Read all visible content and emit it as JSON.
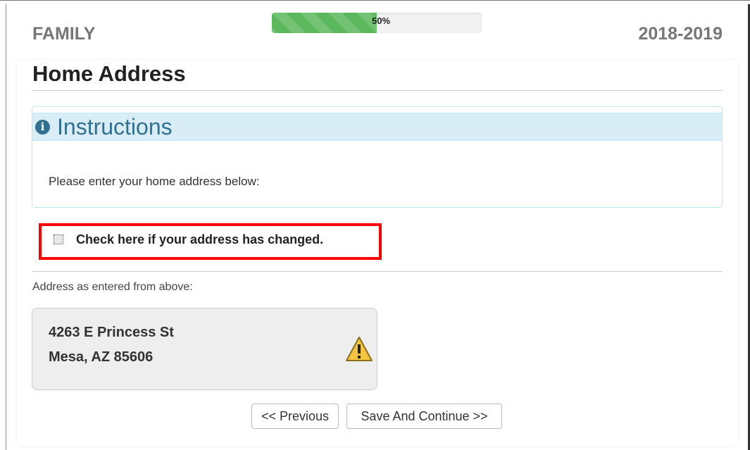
{
  "header": {
    "section": "FAMILY",
    "year": "2018-2019",
    "progress": {
      "percent": 50,
      "label": "50%"
    }
  },
  "page": {
    "title": "Home Address"
  },
  "instructions": {
    "title": "Instructions",
    "icon": "info-circle-icon",
    "body": "Please enter your home address below:"
  },
  "address_changed": {
    "label": "Check here if your address has changed.",
    "checked": false
  },
  "address": {
    "caption": "Address as entered from above:",
    "line1": "4263 E Princess St",
    "line2": "Mesa, AZ 85606",
    "status_icon": "warning-icon"
  },
  "nav": {
    "previous_label": "<< Previous",
    "save_label": "Save And Continue >>"
  },
  "colors": {
    "progress": "#5cb85c",
    "info_text": "#31708f",
    "info_bg": "#d9edf7",
    "highlight": "#ff0000"
  }
}
